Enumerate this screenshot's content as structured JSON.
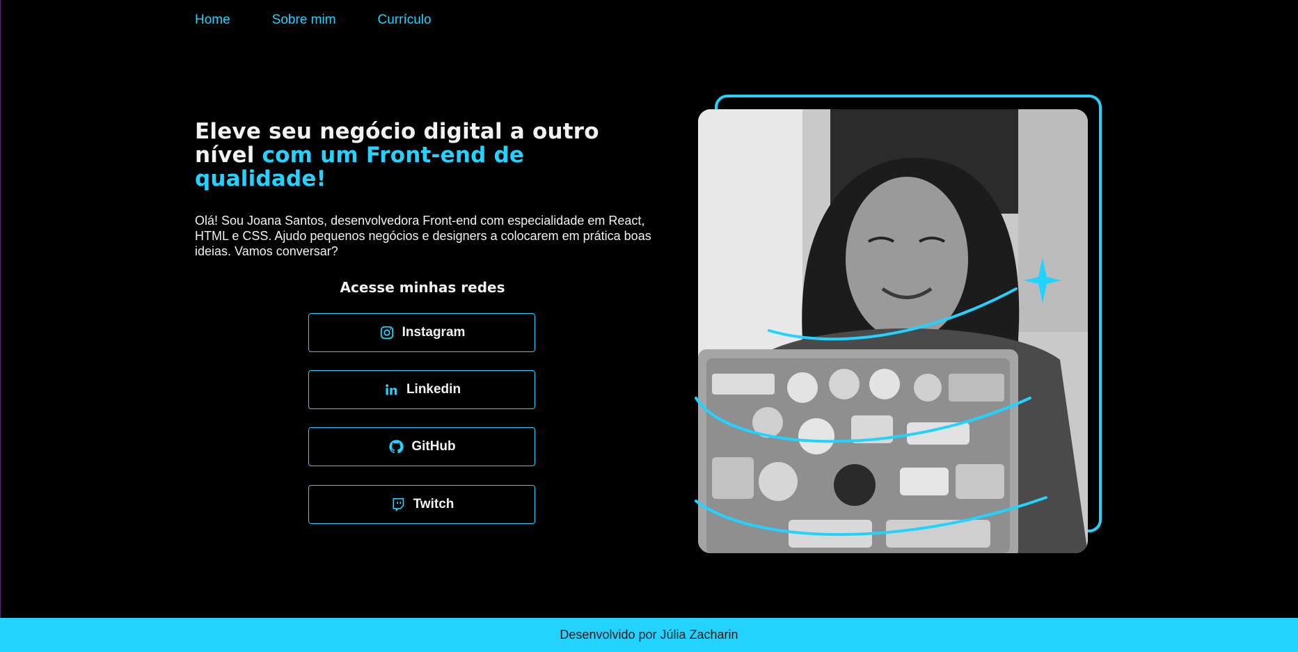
{
  "nav": {
    "items": [
      {
        "label": "Home"
      },
      {
        "label": "Sobre mim"
      },
      {
        "label": "Currículo"
      }
    ]
  },
  "hero": {
    "title_part1": "Eleve seu negócio digital a outro nível ",
    "title_accent": "com um Front-end de qualidade!",
    "description": "Olá! Sou Joana Santos, desenvolvedora Front-end com especialidade em React, HTML e CSS. Ajudo pequenos negócios e designers a colocarem em prática boas ideias. Vamos conversar?"
  },
  "social": {
    "title": "Acesse minhas redes",
    "links": [
      {
        "label": "Instagram",
        "icon": "instagram-icon"
      },
      {
        "label": "Linkedin",
        "icon": "linkedin-icon"
      },
      {
        "label": "GitHub",
        "icon": "github-icon"
      },
      {
        "label": "Twitch",
        "icon": "twitch-icon"
      }
    ]
  },
  "colors": {
    "accent": "#22d3ff",
    "background": "#000000",
    "text": "#f2f2f2"
  },
  "footer": {
    "text": "Desenvolvido por Júlia Zacharin"
  }
}
